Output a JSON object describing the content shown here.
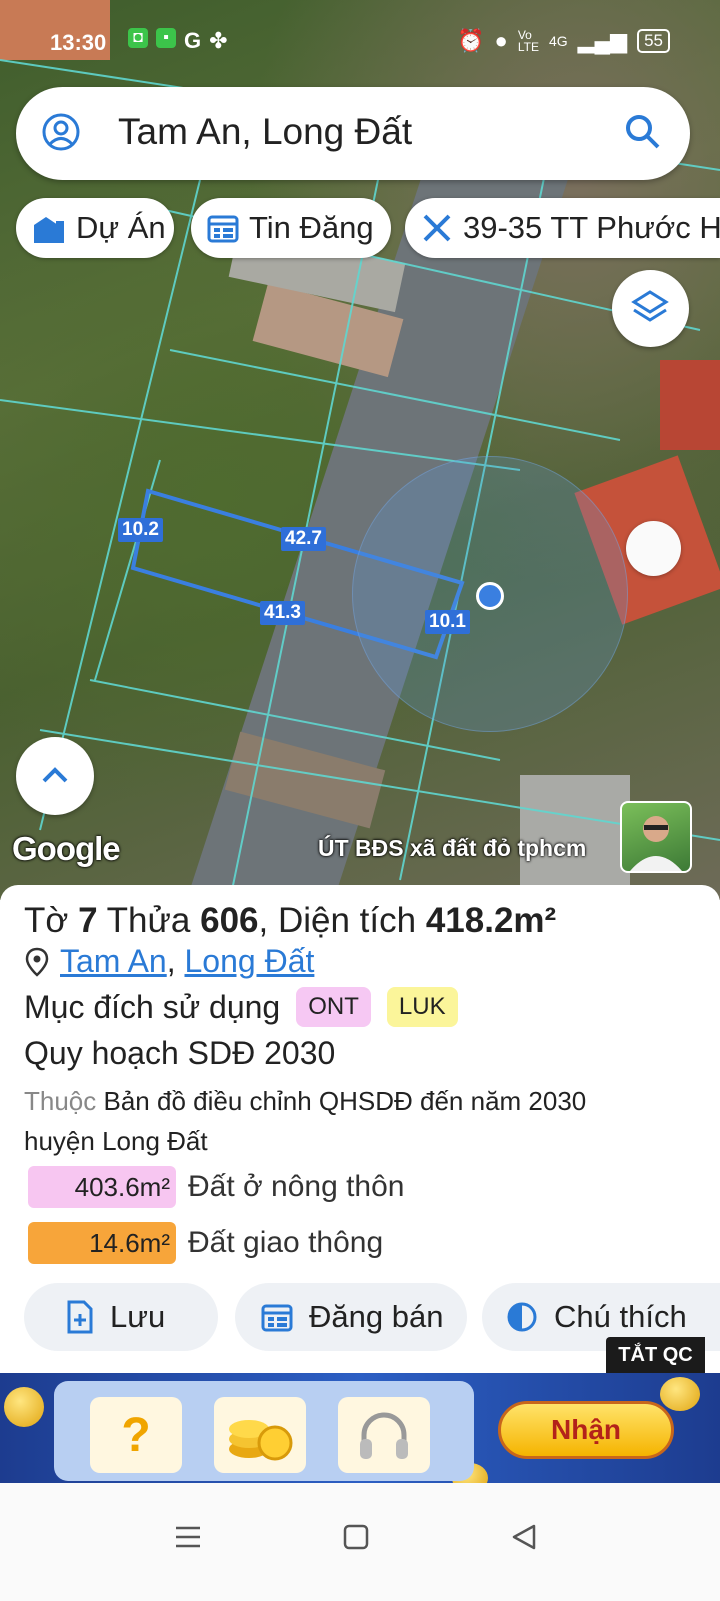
{
  "status_bar": {
    "time": "13:30",
    "battery": "55",
    "network": "4G"
  },
  "search": {
    "query": "Tam An, Long Đất"
  },
  "chips": [
    {
      "label": "Dự Án"
    },
    {
      "label": "Tin Đăng"
    },
    {
      "label": "39-35 TT Phước H"
    }
  ],
  "map": {
    "measurements": [
      "10.2",
      "42.7",
      "41.3",
      "10.1"
    ],
    "attribution": "Google",
    "credit": "ÚT BĐS xã đất đỏ tphcm"
  },
  "parcel": {
    "sheet_prefix": "Tờ",
    "sheet_no": "7",
    "plot_prefix": "Thửa",
    "plot_no": "606",
    "area_prefix": ", Diện tích",
    "area": "418.2m²",
    "location_ward": "Tam An",
    "location_sep": ",",
    "location_district": "Long Đất",
    "usage_label": "Mục đích sử dụng",
    "usage_codes": [
      {
        "code": "ONT",
        "color": "#f6c8f3"
      },
      {
        "code": "LUK",
        "color": "#fbf59a"
      }
    ],
    "plan_title": "Quy hoạch SDĐ 2030",
    "belongs_prefix": "Thuộc",
    "belongs_text": "Bản đồ điều chỉnh QHSDĐ đến năm 2030 huyện Long Đất",
    "zones": [
      {
        "area": "403.6m²",
        "label": "Đất ở nông thôn",
        "color": "#f7c6f1"
      },
      {
        "area": "14.6m²",
        "label": "Đất giao thông",
        "color": "#f7a53a"
      }
    ]
  },
  "actions": [
    {
      "label": "Lưu"
    },
    {
      "label": "Đăng bán"
    },
    {
      "label": "Chú thích"
    }
  ],
  "ad": {
    "close_label": "TẮT QC",
    "cta_label": "Nhận",
    "question_mark": "?"
  }
}
